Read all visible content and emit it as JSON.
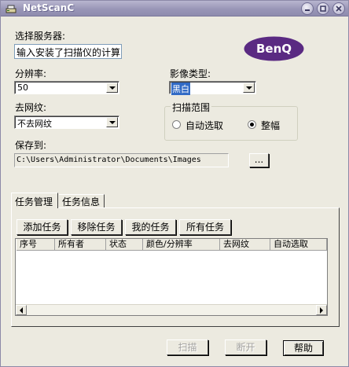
{
  "window": {
    "title": "NetScanC"
  },
  "brand": {
    "logo_text": "BenQ",
    "logo_color": "#5a2a82"
  },
  "server": {
    "label": "选择服务器:",
    "value": "输入安装了扫描仪的计算"
  },
  "resolution": {
    "label": "分辨率:",
    "value": "50"
  },
  "image_type": {
    "label": "影像类型:",
    "value": "黑白"
  },
  "descreen": {
    "label": "去网纹:",
    "value": "不去网纹"
  },
  "scan_area": {
    "label": "扫描范围",
    "options": [
      {
        "label": "自动选取",
        "selected": false
      },
      {
        "label": "整幅",
        "selected": true
      }
    ]
  },
  "save_to": {
    "label": "保存到:",
    "path": "C:\\Users\\Administrator\\Documents\\Images",
    "browse_label": "..."
  },
  "tabs": [
    {
      "label": "任务管理",
      "active": true
    },
    {
      "label": "任务信息",
      "active": false
    }
  ],
  "task_buttons": {
    "add": "添加任务",
    "remove": "移除任务",
    "mine": "我的任务",
    "all": "所有任务"
  },
  "task_table": {
    "columns": [
      "序号",
      "所有者",
      "状态",
      "颜色/分辨率",
      "去网纹",
      "自动选取"
    ],
    "rows": []
  },
  "footer": {
    "scan_label": "扫描",
    "disconnect_label": "断开",
    "help_label": "帮助"
  },
  "colors": {
    "titlebar": "#9996b7",
    "selection": "#316ac5",
    "dialog_bg": "#eceae0"
  }
}
